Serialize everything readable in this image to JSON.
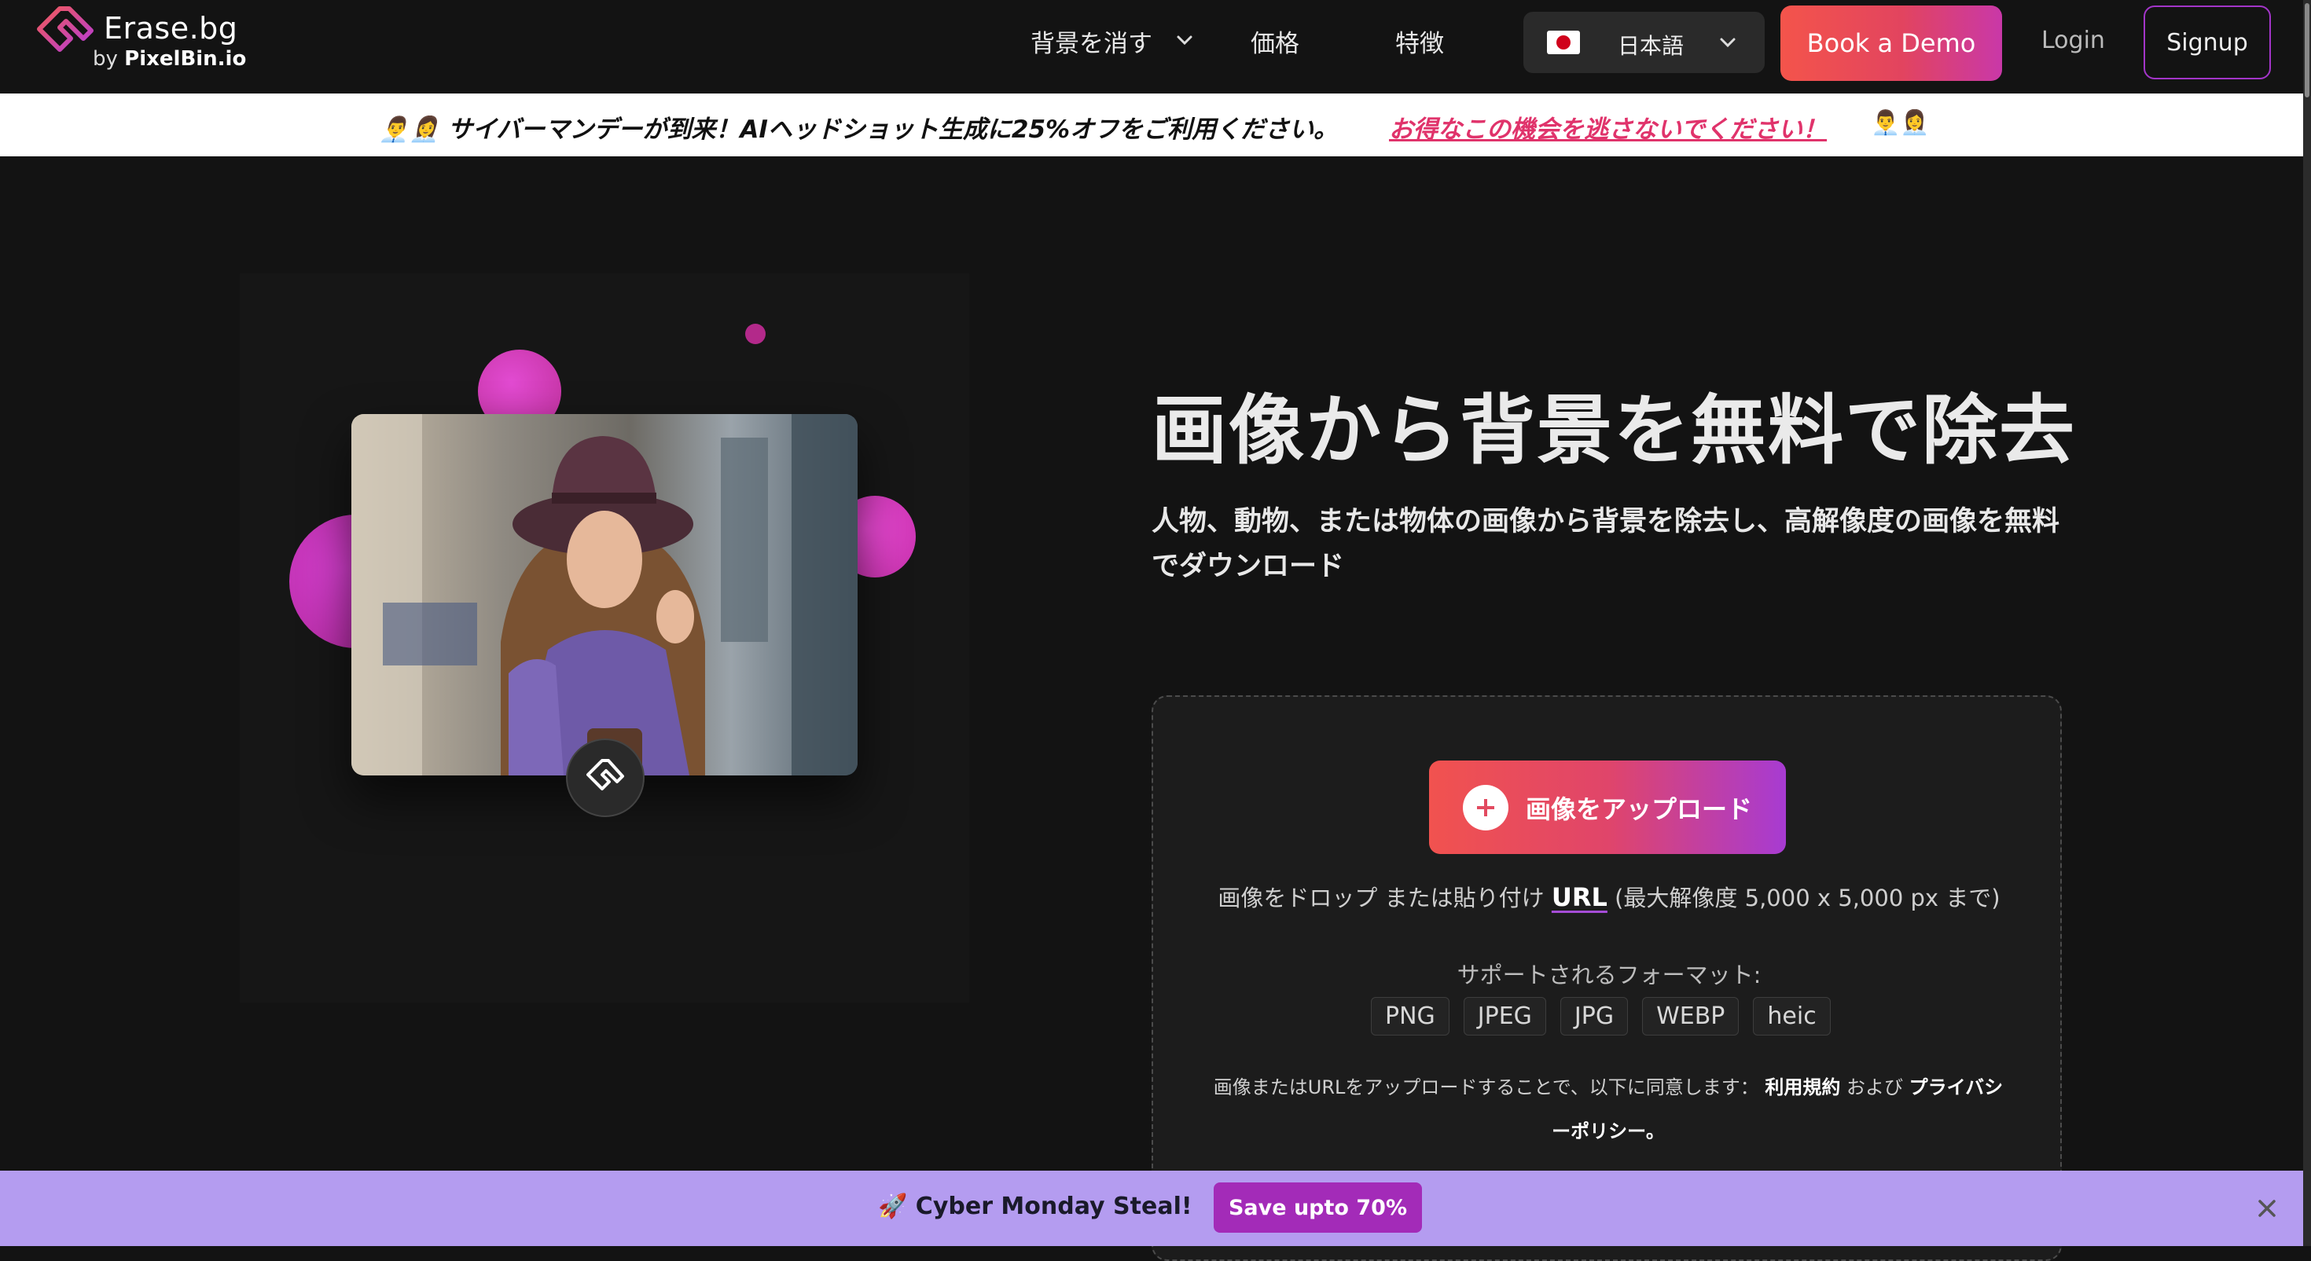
{
  "header": {
    "logo_title": "Erase.bg",
    "logo_sub_prefix": "by ",
    "logo_sub_brand": "PixelBin.io",
    "nav": {
      "remove_bg": "背景を消す",
      "price": "価格",
      "features": "特徴"
    },
    "language": "日本語",
    "book_demo": "Book a Demo",
    "login": "Login",
    "signup": "Signup"
  },
  "promo": {
    "emoji_left": "👨‍💼👩‍💼",
    "text": "サイバーマンデーが到来！AIヘッドショット生成に25%オフをご利用ください。",
    "link": "お得なこの機会を逃さないでください！",
    "emoji_right": "👨‍💼👩‍💼"
  },
  "hero": {
    "title": "画像から背景を無料で除去",
    "subtitle": "人物、動物、または物体の画像から背景を除去し、高解像度の画像を無料でダウンロード"
  },
  "upload": {
    "button": "画像をアップロード",
    "drop_prefix": "画像をドロップ または貼り付け",
    "url": "URL",
    "drop_suffix": "(最大解像度 5,000 x 5,000 px まで)",
    "formats_label": "サポートされるフォーマット:",
    "formats": [
      "PNG",
      "JPEG",
      "JPG",
      "WEBP",
      "heic"
    ],
    "terms_prefix": "画像またはURLをアップロードすることで、以下に同意します：",
    "terms_link": "利用規約",
    "terms_and": "および",
    "privacy_link": "プライバシーポリシー。"
  },
  "banner": {
    "text": "🚀 Cyber Monday Steal!",
    "button": "Save upto 70%"
  },
  "colors": {
    "accent_red": "#f4544b",
    "accent_purple": "#a73bd2",
    "banner_bg": "#b49cf0",
    "page_bg": "#131313"
  }
}
